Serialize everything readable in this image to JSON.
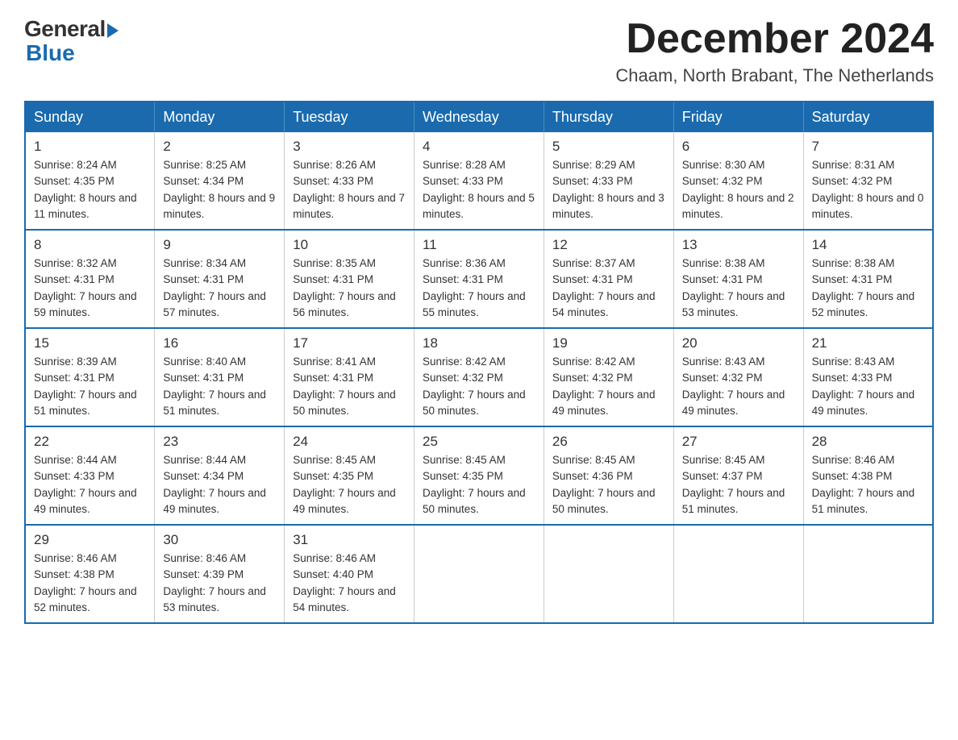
{
  "logo": {
    "general": "General",
    "blue": "Blue"
  },
  "title": "December 2024",
  "location": "Chaam, North Brabant, The Netherlands",
  "weekdays": [
    "Sunday",
    "Monday",
    "Tuesday",
    "Wednesday",
    "Thursday",
    "Friday",
    "Saturday"
  ],
  "weeks": [
    [
      {
        "day": "1",
        "sunrise": "8:24 AM",
        "sunset": "4:35 PM",
        "daylight": "8 hours and 11 minutes"
      },
      {
        "day": "2",
        "sunrise": "8:25 AM",
        "sunset": "4:34 PM",
        "daylight": "8 hours and 9 minutes"
      },
      {
        "day": "3",
        "sunrise": "8:26 AM",
        "sunset": "4:33 PM",
        "daylight": "8 hours and 7 minutes"
      },
      {
        "day": "4",
        "sunrise": "8:28 AM",
        "sunset": "4:33 PM",
        "daylight": "8 hours and 5 minutes"
      },
      {
        "day": "5",
        "sunrise": "8:29 AM",
        "sunset": "4:33 PM",
        "daylight": "8 hours and 3 minutes"
      },
      {
        "day": "6",
        "sunrise": "8:30 AM",
        "sunset": "4:32 PM",
        "daylight": "8 hours and 2 minutes"
      },
      {
        "day": "7",
        "sunrise": "8:31 AM",
        "sunset": "4:32 PM",
        "daylight": "8 hours and 0 minutes"
      }
    ],
    [
      {
        "day": "8",
        "sunrise": "8:32 AM",
        "sunset": "4:31 PM",
        "daylight": "7 hours and 59 minutes"
      },
      {
        "day": "9",
        "sunrise": "8:34 AM",
        "sunset": "4:31 PM",
        "daylight": "7 hours and 57 minutes"
      },
      {
        "day": "10",
        "sunrise": "8:35 AM",
        "sunset": "4:31 PM",
        "daylight": "7 hours and 56 minutes"
      },
      {
        "day": "11",
        "sunrise": "8:36 AM",
        "sunset": "4:31 PM",
        "daylight": "7 hours and 55 minutes"
      },
      {
        "day": "12",
        "sunrise": "8:37 AM",
        "sunset": "4:31 PM",
        "daylight": "7 hours and 54 minutes"
      },
      {
        "day": "13",
        "sunrise": "8:38 AM",
        "sunset": "4:31 PM",
        "daylight": "7 hours and 53 minutes"
      },
      {
        "day": "14",
        "sunrise": "8:38 AM",
        "sunset": "4:31 PM",
        "daylight": "7 hours and 52 minutes"
      }
    ],
    [
      {
        "day": "15",
        "sunrise": "8:39 AM",
        "sunset": "4:31 PM",
        "daylight": "7 hours and 51 minutes"
      },
      {
        "day": "16",
        "sunrise": "8:40 AM",
        "sunset": "4:31 PM",
        "daylight": "7 hours and 51 minutes"
      },
      {
        "day": "17",
        "sunrise": "8:41 AM",
        "sunset": "4:31 PM",
        "daylight": "7 hours and 50 minutes"
      },
      {
        "day": "18",
        "sunrise": "8:42 AM",
        "sunset": "4:32 PM",
        "daylight": "7 hours and 50 minutes"
      },
      {
        "day": "19",
        "sunrise": "8:42 AM",
        "sunset": "4:32 PM",
        "daylight": "7 hours and 49 minutes"
      },
      {
        "day": "20",
        "sunrise": "8:43 AM",
        "sunset": "4:32 PM",
        "daylight": "7 hours and 49 minutes"
      },
      {
        "day": "21",
        "sunrise": "8:43 AM",
        "sunset": "4:33 PM",
        "daylight": "7 hours and 49 minutes"
      }
    ],
    [
      {
        "day": "22",
        "sunrise": "8:44 AM",
        "sunset": "4:33 PM",
        "daylight": "7 hours and 49 minutes"
      },
      {
        "day": "23",
        "sunrise": "8:44 AM",
        "sunset": "4:34 PM",
        "daylight": "7 hours and 49 minutes"
      },
      {
        "day": "24",
        "sunrise": "8:45 AM",
        "sunset": "4:35 PM",
        "daylight": "7 hours and 49 minutes"
      },
      {
        "day": "25",
        "sunrise": "8:45 AM",
        "sunset": "4:35 PM",
        "daylight": "7 hours and 50 minutes"
      },
      {
        "day": "26",
        "sunrise": "8:45 AM",
        "sunset": "4:36 PM",
        "daylight": "7 hours and 50 minutes"
      },
      {
        "day": "27",
        "sunrise": "8:45 AM",
        "sunset": "4:37 PM",
        "daylight": "7 hours and 51 minutes"
      },
      {
        "day": "28",
        "sunrise": "8:46 AM",
        "sunset": "4:38 PM",
        "daylight": "7 hours and 51 minutes"
      }
    ],
    [
      {
        "day": "29",
        "sunrise": "8:46 AM",
        "sunset": "4:38 PM",
        "daylight": "7 hours and 52 minutes"
      },
      {
        "day": "30",
        "sunrise": "8:46 AM",
        "sunset": "4:39 PM",
        "daylight": "7 hours and 53 minutes"
      },
      {
        "day": "31",
        "sunrise": "8:46 AM",
        "sunset": "4:40 PM",
        "daylight": "7 hours and 54 minutes"
      },
      null,
      null,
      null,
      null
    ]
  ]
}
